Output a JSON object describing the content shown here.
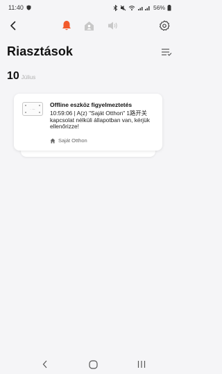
{
  "status_bar": {
    "time": "11:40",
    "battery": "56%",
    "icons": [
      "bluetooth-icon",
      "mute-icon",
      "wifi-icon",
      "signal-icon",
      "battery-icon"
    ]
  },
  "top_nav": {
    "back_icon": "chevron-left-icon",
    "tabs": [
      {
        "icon": "bell-icon",
        "active": true
      },
      {
        "icon": "home-person-icon",
        "active": false
      },
      {
        "icon": "speaker-icon",
        "active": false
      }
    ],
    "settings_icon": "gear-icon",
    "accent_color": "#f25a2b"
  },
  "page": {
    "title": "Riasztások",
    "filter_icon": "filter-list-icon"
  },
  "date_group": {
    "day": "10",
    "month": "Július"
  },
  "notification": {
    "title": "Offline eszköz figyelmeztetés",
    "message": "10:59:06 | A(z) \"Saját Otthon\" 1路开关 kapcsolat nélküli állapotban van, kérjük ellenőrizze!",
    "location": "Saját Otthon",
    "location_icon": "home-icon",
    "device_icon": "device-thumbnail-icon"
  },
  "system_nav": {
    "back_icon": "back-chevron-icon",
    "home_icon": "home-circle-icon",
    "recent_icon": "recent-apps-icon"
  }
}
